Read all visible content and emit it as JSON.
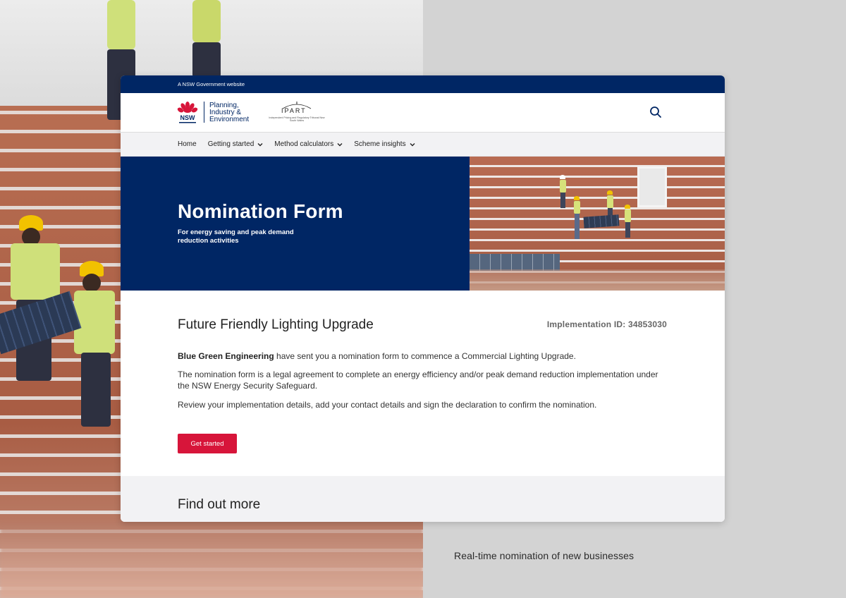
{
  "gov_bar": {
    "text": "A NSW Government website"
  },
  "header": {
    "nsw_logo_label": "NSW",
    "dept_lines": [
      "Planning,",
      "Industry &",
      "Environment"
    ],
    "ipart": {
      "title": "IPART",
      "subtitle": "Independent Pricing and Regulatory Tribunal New South Wales"
    }
  },
  "nav": {
    "items": [
      {
        "label": "Home",
        "dropdown": false
      },
      {
        "label": "Getting started",
        "dropdown": true
      },
      {
        "label": "Method calculators",
        "dropdown": true
      },
      {
        "label": "Scheme insights",
        "dropdown": true
      }
    ]
  },
  "hero": {
    "title": "Nomination Form",
    "subtitle": "For energy saving and peak demand reduction activities"
  },
  "content": {
    "project_title": "Future Friendly Lighting Upgrade",
    "implementation_id": "Implementation ID: 34853030",
    "p1_company": "Blue Green Engineering",
    "p1_rest": " have sent you a nomination form to commence a Commercial Lighting Upgrade.",
    "p2": "The nomination form is a legal agreement to complete an energy efficiency and/or peak demand reduction implementation under the NSW Energy Security Safeguard.",
    "p3": "Review your implementation details, add your contact details and sign the declaration to confirm the nomination.",
    "cta_label": "Get started"
  },
  "find_more": {
    "title": "Find out more"
  },
  "caption": "Real-time nomination of new businesses",
  "colors": {
    "navy": "#002664",
    "red": "#d7153a",
    "nav_bg": "#f2f2f4"
  },
  "icons": [
    "waratah-logo",
    "search-icon",
    "chevron-down-icon"
  ]
}
